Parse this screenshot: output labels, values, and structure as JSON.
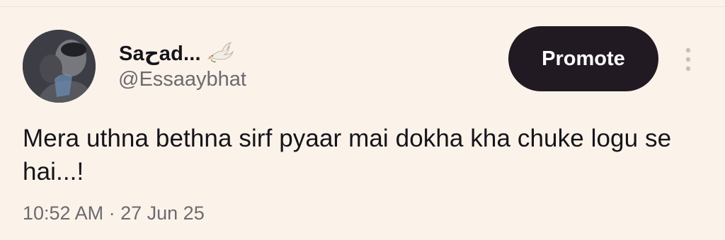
{
  "tweet": {
    "author": {
      "display_name": "Saحad...",
      "handle": "@Essaaybhat",
      "badge_icon": "dove-icon"
    },
    "actions": {
      "promote_label": "Promote",
      "more_icon": "vertical-ellipsis-icon"
    },
    "text": "Mera uthna bethna sirf pyaar mai dokha kha chuke logu se hai...!",
    "meta": {
      "time": "10:52 AM",
      "separator": "·",
      "date": "27 Jun 25"
    }
  },
  "colors": {
    "background": "#fbf3ea",
    "promote_bg": "#221a22",
    "primary_text": "#15141a",
    "secondary_text": "#6c6a70"
  }
}
